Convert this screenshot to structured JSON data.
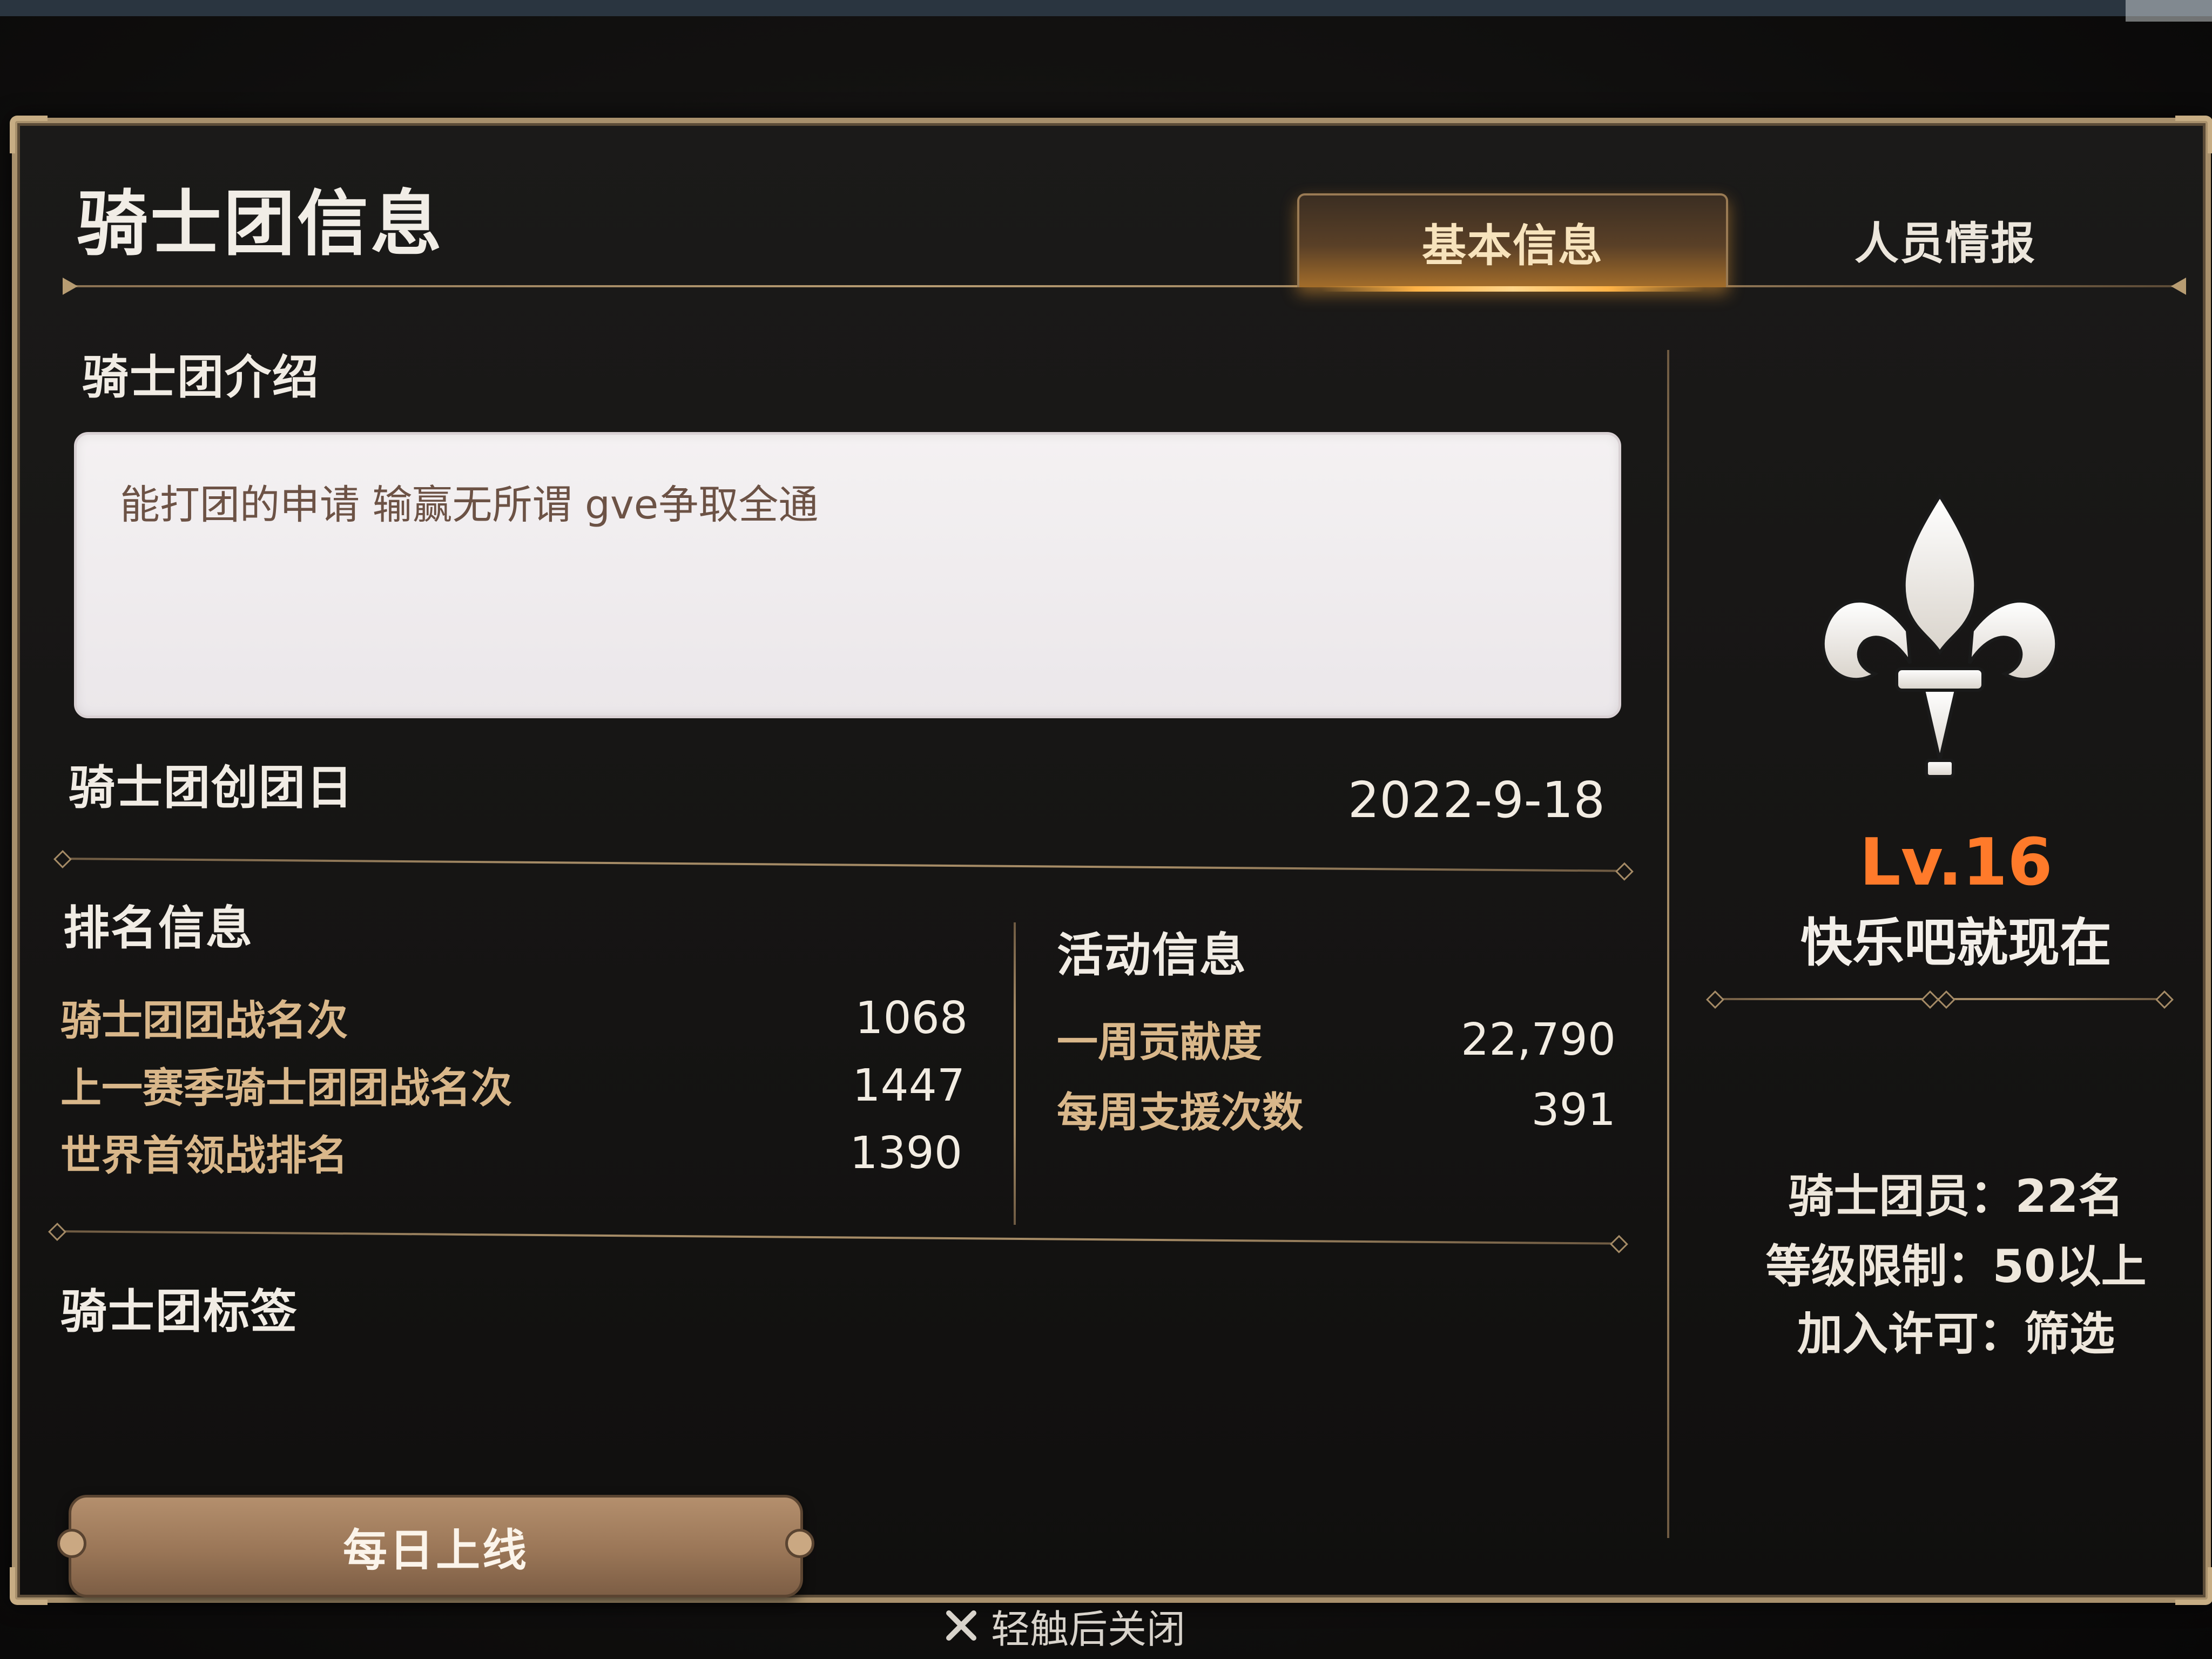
{
  "title": "骑士团信息",
  "tabs": [
    {
      "label": "基本信息",
      "active": true
    },
    {
      "label": "人员情报",
      "active": false
    }
  ],
  "intro": {
    "heading": "骑士团介绍",
    "text": "能打团的申请 输赢无所谓 gve争取全通"
  },
  "founded": {
    "label": "骑士团创团日",
    "date": "2022-9-18"
  },
  "ranking": {
    "heading": "排名信息",
    "rows": [
      {
        "label": "骑士团团战名次",
        "value": "1068"
      },
      {
        "label": "上一赛季骑士团团战名次",
        "value": "1447"
      },
      {
        "label": "世界首领战排名",
        "value": "1390"
      }
    ]
  },
  "activity": {
    "heading": "活动信息",
    "rows": [
      {
        "label": "一周贡献度",
        "value": "22,790"
      },
      {
        "label": "每周支援次数",
        "value": "391"
      }
    ]
  },
  "tags": {
    "heading": "骑士团标签",
    "items": [
      "每日上线"
    ]
  },
  "guild": {
    "emblem": "fleur-de-lis-icon",
    "level": "Lv.16",
    "name": "快乐吧就现在",
    "members": "骑士团员：22名",
    "level_limit": "等级限制：50以上",
    "join_permission": "加入许可：筛选"
  },
  "close_hint": "轻触后关闭",
  "colors": {
    "accent_gold": "#a58b66",
    "level_orange": "#ff7a2a",
    "tab_glow": "#ffb347"
  }
}
